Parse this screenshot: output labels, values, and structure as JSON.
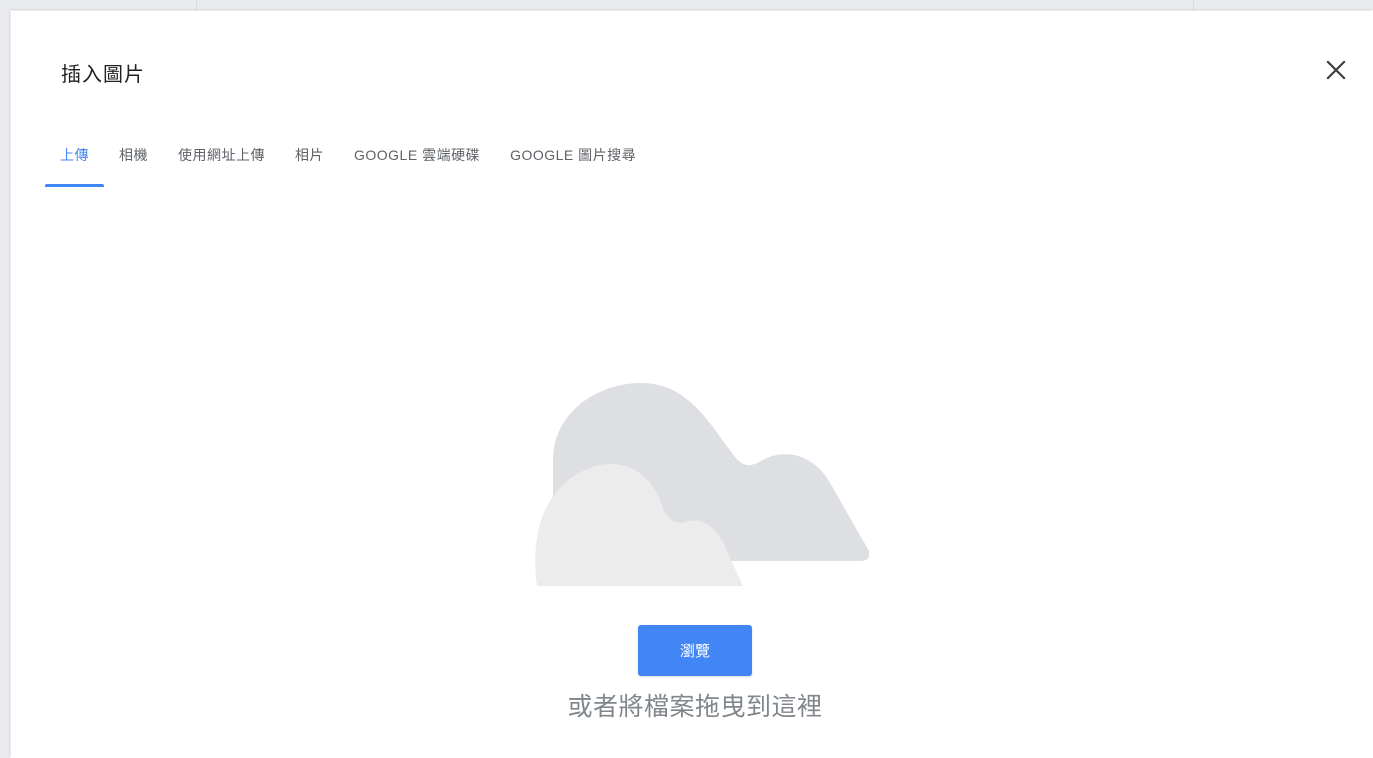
{
  "dialog": {
    "title": "插入圖片",
    "close_icon": "close-icon"
  },
  "tabs": [
    {
      "label": "上傳",
      "active": true
    },
    {
      "label": "相機",
      "active": false
    },
    {
      "label": "使用網址上傳",
      "active": false
    },
    {
      "label": "相片",
      "active": false
    },
    {
      "label": "GOOGLE 雲端硬碟",
      "active": false
    },
    {
      "label": "GOOGLE 圖片搜尋",
      "active": false
    }
  ],
  "upload": {
    "illustration": "cloud-icon",
    "browse_label": "瀏覽",
    "drop_hint": "或者將檔案拖曳到這裡"
  },
  "colors": {
    "accent": "#4285f4",
    "tab_text": "#5f6368",
    "hint_text": "#80868b",
    "cloud_back": "#dedfe2",
    "cloud_front": "#ececed"
  }
}
